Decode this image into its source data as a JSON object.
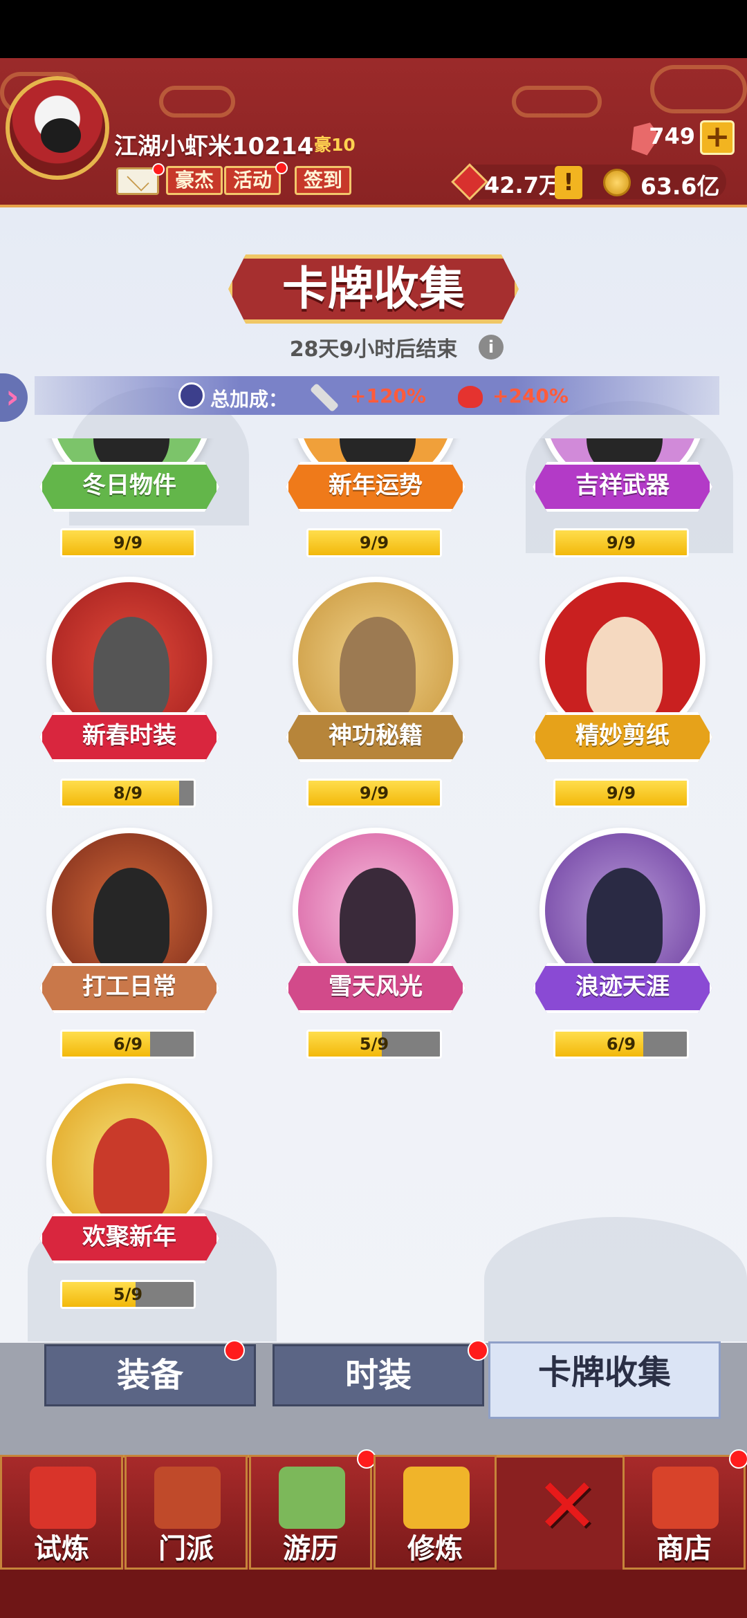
{
  "header": {
    "nickname": "江湖小虾米10214",
    "vip": "豪10",
    "buttons": [
      "豪杰",
      "活动",
      "签到"
    ],
    "gems": "749",
    "plus": "+",
    "honor": "42.7万",
    "excl": "!",
    "coins": "63.6亿"
  },
  "page": {
    "title": "卡牌收集",
    "countdown": "28天9小时后结束",
    "info": "i",
    "bonus_label": "总加成：",
    "attack_bonus": "+120%",
    "hp_bonus": "+240%"
  },
  "cards": [
    {
      "name": "冬日物件",
      "progress": "9/9",
      "ratio": 1.0,
      "color": "#63b64a"
    },
    {
      "name": "新年运势",
      "progress": "9/9",
      "ratio": 1.0,
      "color": "#ef7a1a"
    },
    {
      "name": "吉祥武器",
      "progress": "9/9",
      "ratio": 1.0,
      "color": "#b33ac7"
    },
    {
      "name": "新春时装",
      "progress": "8/9",
      "ratio": 0.889,
      "color": "#d9263e"
    },
    {
      "name": "神功秘籍",
      "progress": "9/9",
      "ratio": 1.0,
      "color": "#b7853a"
    },
    {
      "name": "精妙剪纸",
      "progress": "9/9",
      "ratio": 1.0,
      "color": "#e6a21a"
    },
    {
      "name": "打工日常",
      "progress": "6/9",
      "ratio": 0.667,
      "color": "#c9784a"
    },
    {
      "name": "雪天风光",
      "progress": "5/9",
      "ratio": 0.556,
      "color": "#d24a8a"
    },
    {
      "name": "浪迹天涯",
      "progress": "6/9",
      "ratio": 0.667,
      "color": "#8a4ad4"
    },
    {
      "name": "欢聚新年",
      "progress": "5/9",
      "ratio": 0.556,
      "color": "#d9263e"
    }
  ],
  "tabs": [
    "装备",
    "时装",
    "卡牌收集"
  ],
  "nav": [
    "试炼",
    "门派",
    "游历",
    "修炼",
    "商店"
  ]
}
